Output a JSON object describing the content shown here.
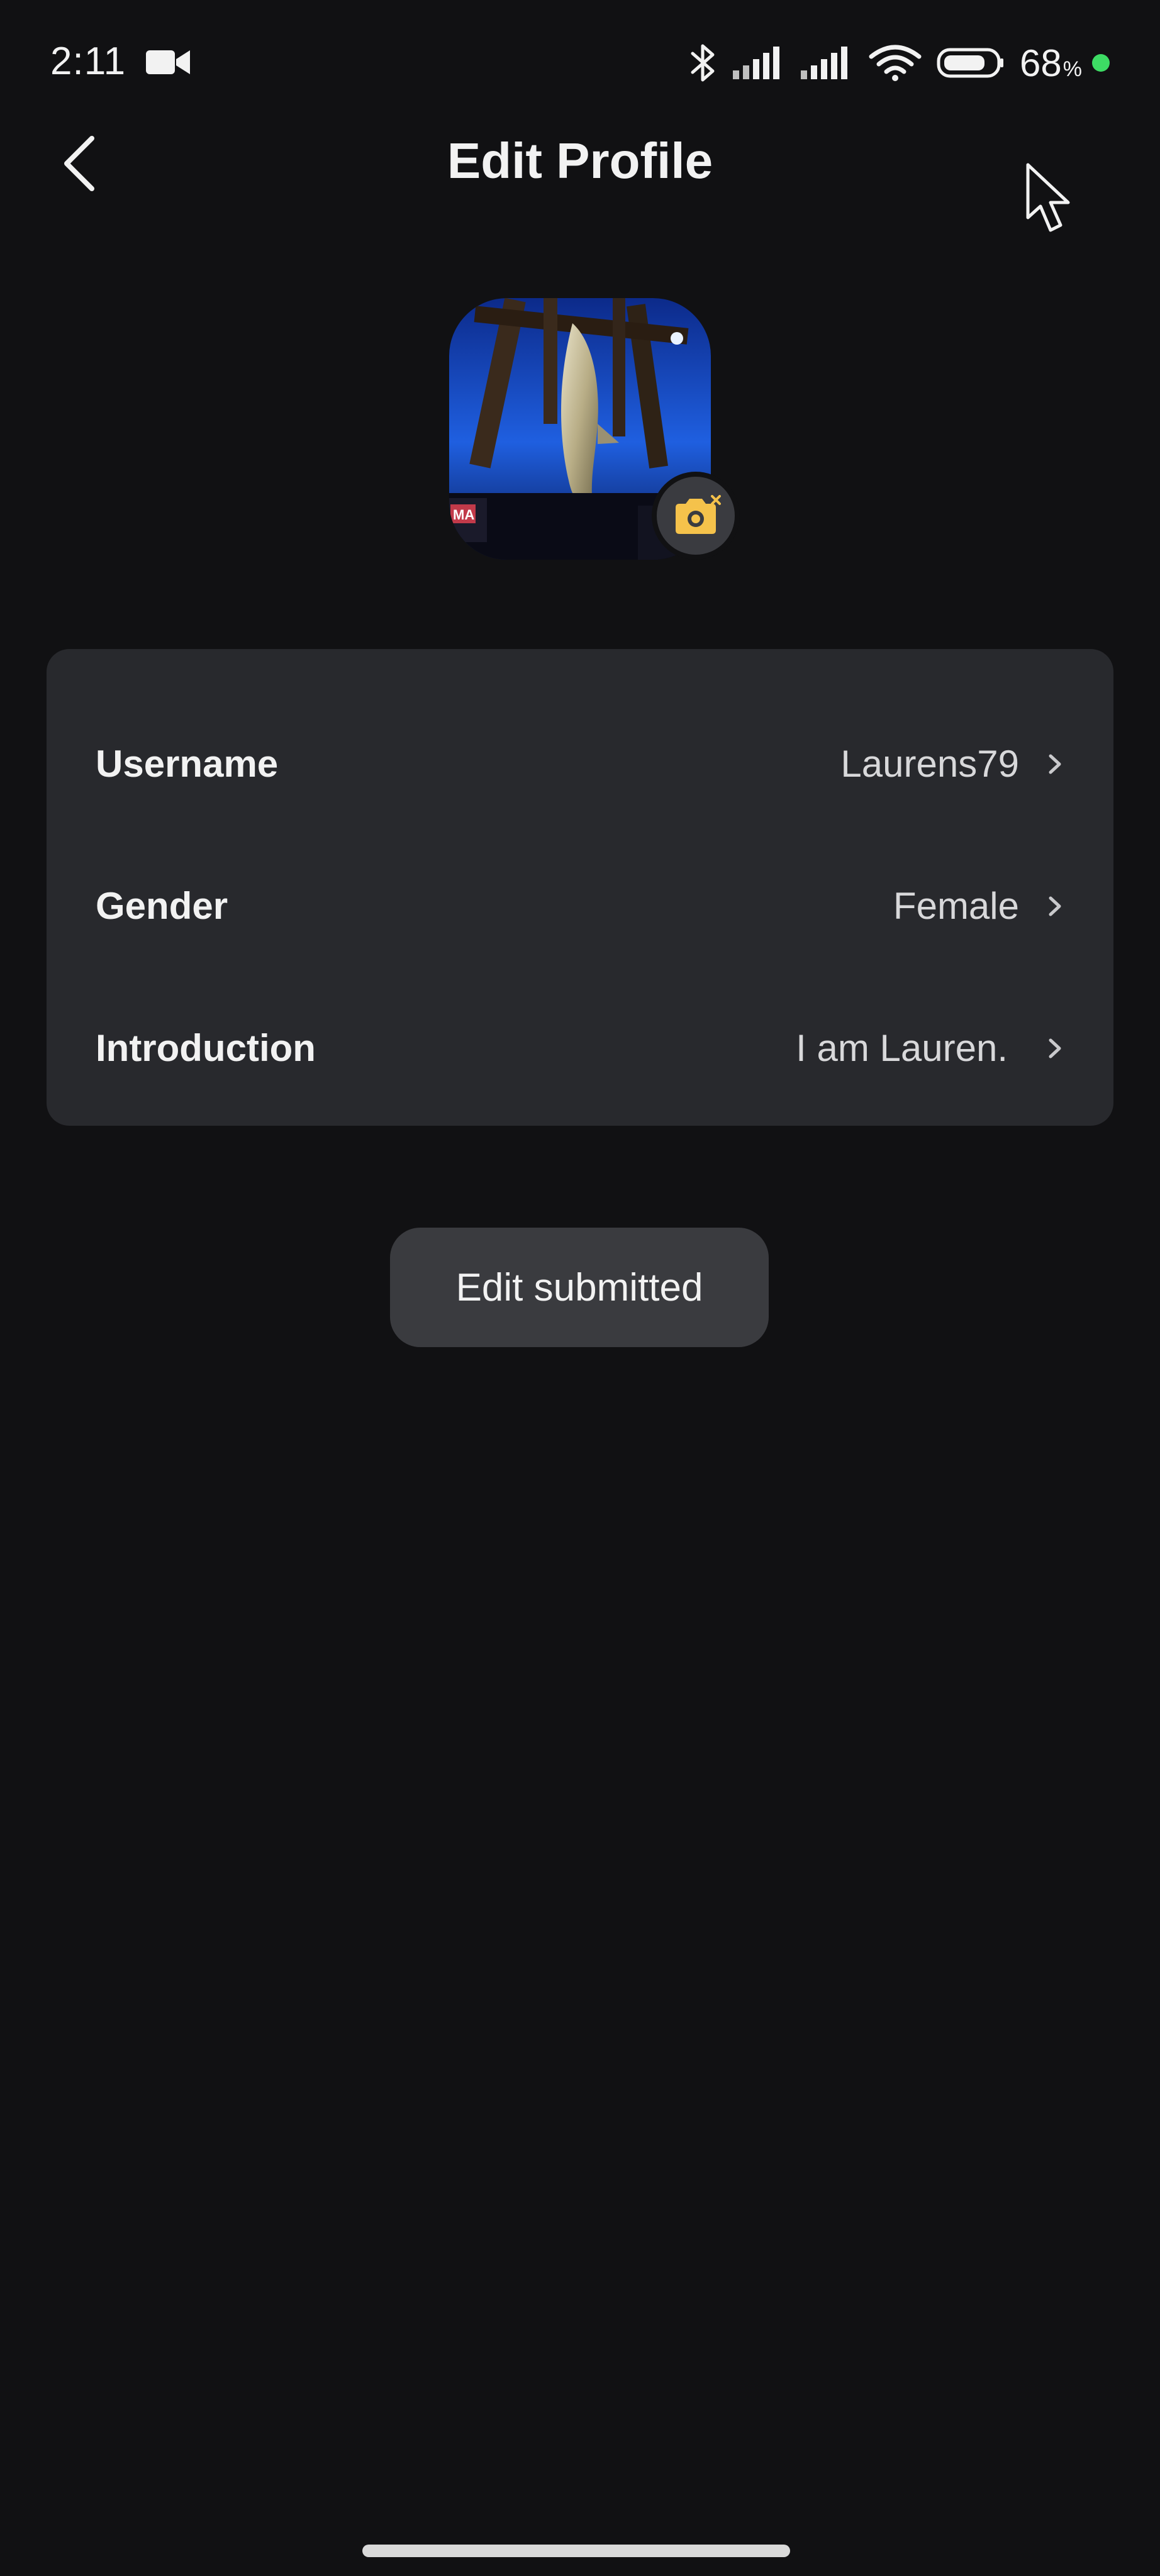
{
  "status_bar": {
    "time": "2:11",
    "battery_value": "68",
    "battery_unit": "%",
    "icons": [
      "video-camera-icon",
      "bluetooth-icon",
      "signal-icon",
      "signal-icon",
      "wifi-icon",
      "battery-icon",
      "charging-dot-icon"
    ],
    "colors": {
      "charging_dot": "#3ddc64"
    }
  },
  "header": {
    "title": "Edit Profile",
    "back_icon": "chevron-left-icon"
  },
  "avatar": {
    "camera_badge_icon": "camera-icon",
    "camera_accent": "#f5c24b",
    "overlay_text": "MA"
  },
  "profile_fields": [
    {
      "label": "Username",
      "value": "Laurens79"
    },
    {
      "label": "Gender",
      "value": "Female"
    },
    {
      "label": "Introduction",
      "value": "I am Lauren."
    }
  ],
  "toast": {
    "message": "Edit submitted"
  },
  "theme": {
    "background": "#111113",
    "card": "#28292d",
    "toast": "#3a3b3f"
  }
}
